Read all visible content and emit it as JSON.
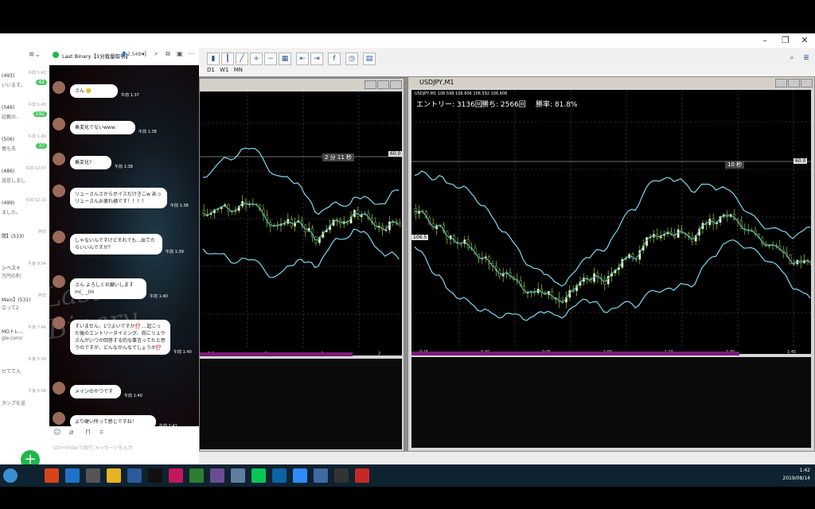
{
  "line": {
    "sidebar_items": [
      {
        "title": "(493)",
        "preview": "いいます。",
        "time": "午前 1:42",
        "badge": "42"
      },
      {
        "title": "(546)",
        "preview": "記載の..",
        "time": "午前 1:40",
        "badge": "192"
      },
      {
        "title": "(506)",
        "preview": "復も夫",
        "time": "午前 1:40",
        "badge": "37"
      },
      {
        "title": "(486)",
        "preview": "送信しまし",
        "time": "午前 12:07",
        "badge": ""
      },
      {
        "title": "(499)",
        "preview": "ました。",
        "time": "午前 12:11",
        "badge": ""
      },
      {
        "title": "間】(533)",
        "preview": "",
        "time": "昨日",
        "badge": ""
      },
      {
        "title": "ンベスト",
        "preview": "万円の利",
        "time": "午後 9:04",
        "badge": ""
      },
      {
        "title": "Main】(531)",
        "preview": "立って2",
        "time": "昨日",
        "badge": ""
      },
      {
        "title": "MOトレ...",
        "preview": "gle.com/",
        "time": "午後 7:46",
        "badge": ""
      },
      {
        "title": "",
        "preview": "せてて入",
        "time": "午後 5:09",
        "badge": ""
      },
      {
        "title": "",
        "preview": "タンプを送",
        "time": "午後 5:08",
        "badge": ""
      }
    ],
    "fab_label": "+",
    "chat": {
      "title": "Last Binary【1分裁量取引】",
      "member_count": "2,548",
      "messages": [
        {
          "text": "さん 🙂",
          "time": "午前 1:37"
        },
        {
          "text": "乗変化でないwww",
          "time": "午前 1:38"
        },
        {
          "text": "乗変化?",
          "time": "午前 1:38"
        },
        {
          "text": "リューさんさからボイスだけきこw あっリューさんお疲れ様です！！！！",
          "time": "午前 1:38"
        },
        {
          "text": "しゃないんですけどそれでも...出てたらいいんですか？",
          "time": "午前 1:39"
        },
        {
          "text": "さん よろしくお願いします m(_ _)m",
          "time": "午前 1:40"
        },
        {
          "text": "すいません、1つよいですか⁉️ ...起こった後のエントリータイミング、前にリュウさんがいつか回答する的な事言ってたと思うのですが、どんなかんなでしょうか⁉️",
          "time": "午前 1:40"
        },
        {
          "text": "メインのやつです",
          "time": "午前 1:40"
        },
        {
          "text": "より硬い所って感じですね！",
          "time": "午前 1:41"
        }
      ],
      "input_placeholder": "Ctrl+Enterで改行 メッセージを入力"
    }
  },
  "mt4": {
    "periods": [
      "D1",
      "W1",
      "MN"
    ],
    "left_chart": {
      "price_label": "60.0",
      "countdown": "2 分 11 秒",
      "time_labels": [
        "2:1",
        "0",
        "1",
        "2"
      ]
    },
    "right_chart": {
      "title": "USDJPY,M1",
      "quote_line": "USDJPY,M1  106.598 106.606 106.592 106.606",
      "stats_entry": "エントリー: 3136回",
      "stats_wins": "勝ち: 2566回",
      "stats_rate": "勝率: 81.8%",
      "countdown": "10 秒",
      "price_label": "60.0",
      "level_label": "106.5",
      "time_labels": [
        "0:15",
        "0:30",
        "0:45",
        "1:00",
        "1:15",
        "1:30",
        "1:45"
      ]
    }
  },
  "taskbar": {
    "time": "1:42",
    "date": "2019/08/14",
    "icons": [
      "windows-icon",
      "search-icon",
      "app-red-icon",
      "edge-icon",
      "store-icon",
      "explorer-icon",
      "mail-icon",
      "xm-icon",
      "app-pink-icon",
      "green-app-icon",
      "film-icon",
      "notepad-icon",
      "line-icon",
      "app-blue-icon",
      "zoom-icon",
      "photos-icon",
      "app-dark-icon",
      "app-red2-icon"
    ]
  }
}
